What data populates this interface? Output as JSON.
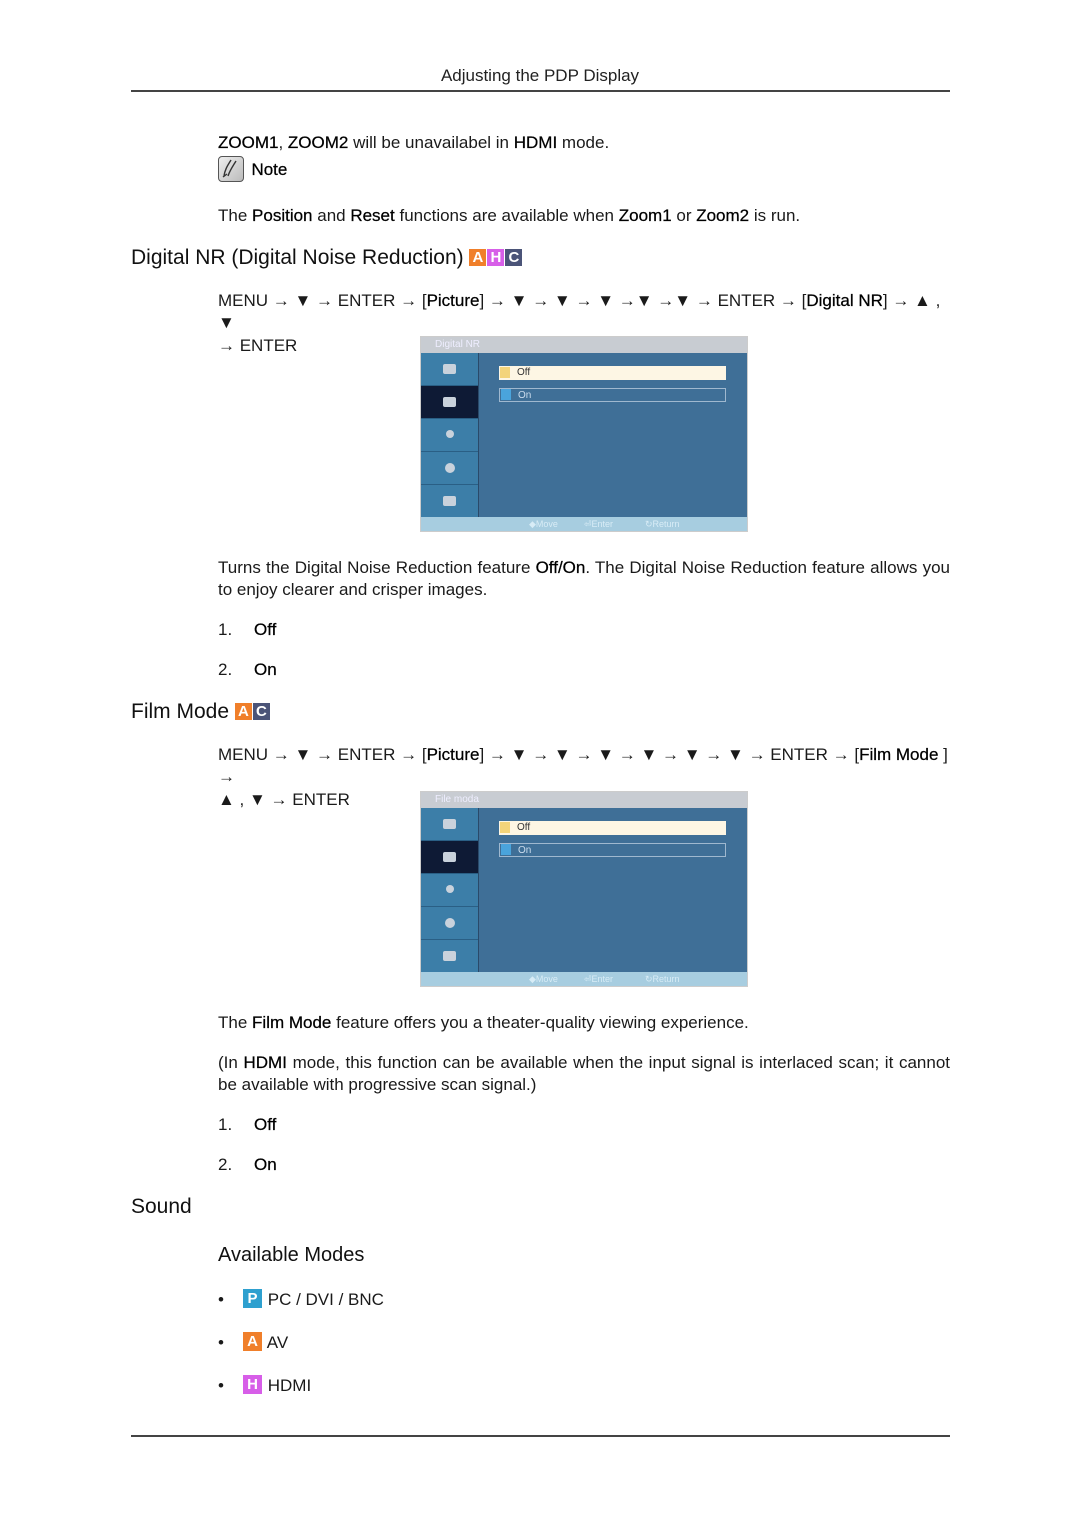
{
  "header": {
    "title": "Adjusting the PDP Display"
  },
  "intro": {
    "zoom_line": {
      "b1": "ZOOM1",
      "t1": ", ",
      "b2": "ZOOM2",
      "t2": " will be unavailabel in ",
      "b3": "HDMI",
      "t3": " mode."
    },
    "note_label": "Note",
    "note_icon": "note-pencil-icon",
    "note_text": {
      "t1": "The ",
      "b1": "Position",
      "t2": " and ",
      "b2": "Reset",
      "t3": " functions are available when ",
      "b3": "Zoom1",
      "t4": " or ",
      "b4": "Zoom2",
      "t5": " is run."
    }
  },
  "digital_nr": {
    "heading": "Digital NR (Digital Noise Reduction)",
    "badges": [
      "A",
      "H",
      "C"
    ],
    "path_line1": {
      "t1": "MENU → ▼ → ENTER → [",
      "b1": "Picture",
      "t2": "] → ▼ → ▼ → ▼ →▼ →▼ → ENTER → [",
      "b2": "Digital NR",
      "t3": "] → ▲ , ▼"
    },
    "path_line2": "→ ENTER",
    "osd": {
      "title": "Digital  NR",
      "options": [
        "Off",
        "On"
      ],
      "selected": "Off",
      "footer": {
        "move": "Move",
        "enter": "Enter",
        "return": "Return"
      }
    },
    "description": {
      "t1": "Turns the Digital Noise Reduction feature ",
      "b1": "Off/On",
      "t2": ". The Digital Noise Reduction feature allows you to enjoy clearer and crisper images."
    },
    "list": [
      {
        "num": "1.",
        "label": "Off"
      },
      {
        "num": "2.",
        "label": "On"
      }
    ]
  },
  "film_mode": {
    "heading": "Film Mode",
    "badges": [
      "A",
      "C"
    ],
    "path_line1": {
      "t1": "MENU → ▼ → ENTER → [",
      "b1": "Picture",
      "t2": "] → ▼ → ▼ → ▼ → ▼ → ▼ → ▼ → ENTER → [",
      "b2": "Film Mode ",
      "t3": "] →"
    },
    "path_line2": "▲ , ▼ → ENTER",
    "osd": {
      "title": "File moda",
      "options": [
        "Off",
        "On"
      ],
      "selected": "Off",
      "footer": {
        "move": "Move",
        "enter": "Enter",
        "return": "Return"
      }
    },
    "description": {
      "t1": "The ",
      "b1": "Film Mode",
      "t2": " feature offers you a theater-quality viewing experience."
    },
    "hdmi_note": {
      "t1": "(In ",
      "b1": "HDMI",
      "t2": " mode, this function can be available when the input signal is interlaced scan; it cannot be available with progressive scan signal.)"
    },
    "list": [
      {
        "num": "1.",
        "label": "Off"
      },
      {
        "num": "2.",
        "label": "On"
      }
    ]
  },
  "sound": {
    "heading": "Sound",
    "subheading": "Available Modes",
    "modes": [
      {
        "badge": "P",
        "label": "PC / DVI / BNC",
        "color": "#2ea0cf"
      },
      {
        "badge": "A",
        "label": "AV",
        "color": "#f07f2a"
      },
      {
        "badge": "H",
        "label": "HDMI",
        "color": "#d75ee8"
      }
    ]
  },
  "colors": {
    "badge_a": "#f07f2a",
    "badge_h": "#d75ee8",
    "badge_c": "#4b5478",
    "badge_p": "#2ea0cf",
    "osd_panel": "#3f6f97"
  }
}
